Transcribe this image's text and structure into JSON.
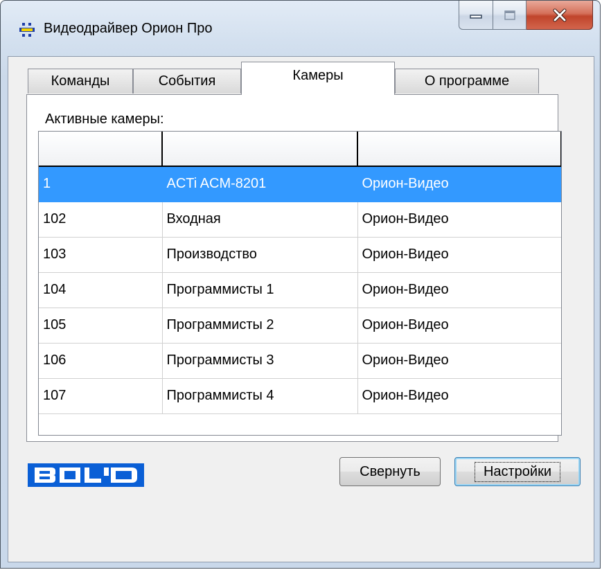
{
  "window": {
    "title": "Видеодрайвер Орион Про",
    "icon": "video-driver-icon"
  },
  "caption_buttons": [
    "minimize-icon",
    "maximize-icon",
    "close-icon"
  ],
  "tabs": [
    {
      "label": "Команды",
      "active": false
    },
    {
      "label": "События",
      "active": false
    },
    {
      "label": "Камеры",
      "active": true
    },
    {
      "label": "О программе",
      "active": false
    }
  ],
  "cameras_panel": {
    "label": "Активные камеры:",
    "columns": [
      "",
      "",
      ""
    ],
    "rows": [
      {
        "id": "1",
        "name": "ACTi ACM-8201",
        "driver": "Орион-Видео",
        "selected": true
      },
      {
        "id": "102",
        "name": "Входная",
        "driver": "Орион-Видео",
        "selected": false
      },
      {
        "id": "103",
        "name": "Производство",
        "driver": "Орион-Видео",
        "selected": false
      },
      {
        "id": "104",
        "name": "Программисты 1",
        "driver": "Орион-Видео",
        "selected": false
      },
      {
        "id": "105",
        "name": "Программисты 2",
        "driver": "Орион-Видео",
        "selected": false
      },
      {
        "id": "106",
        "name": "Программисты 3",
        "driver": "Орион-Видео",
        "selected": false
      },
      {
        "id": "107",
        "name": "Программисты 4",
        "driver": "Орион-Видео",
        "selected": false
      }
    ]
  },
  "logo": {
    "text": "BOLID",
    "color": "#0a5fd6"
  },
  "buttons": {
    "collapse": "Свернуть",
    "settings": "Настройки"
  },
  "colors": {
    "selection": "#3399ff",
    "close_button": "#c0442b"
  }
}
